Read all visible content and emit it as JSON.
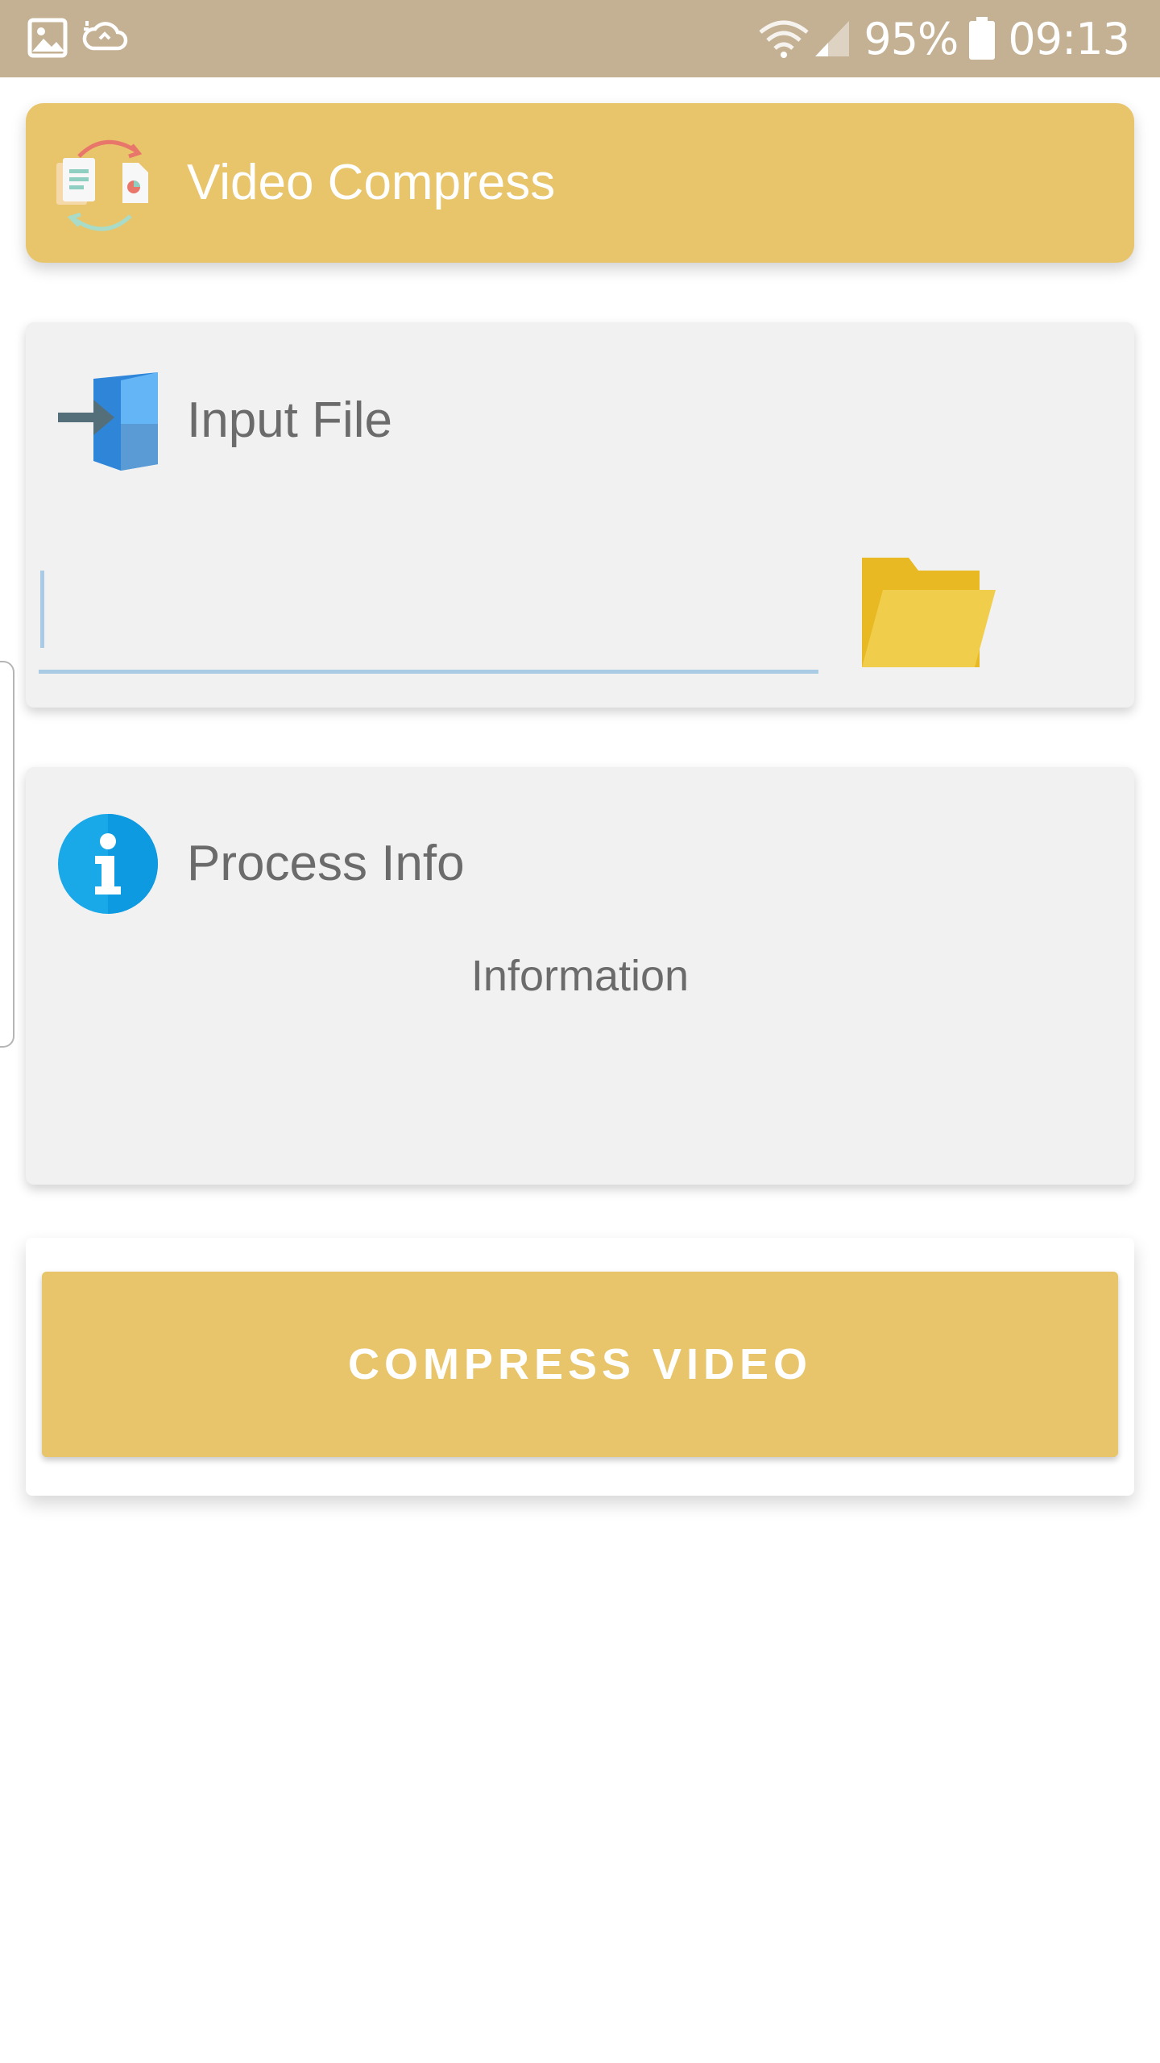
{
  "status_bar": {
    "battery": "95%",
    "time": "09:13",
    "left_icons": [
      "image-icon",
      "sync-cloud-icon"
    ],
    "right_icons": [
      "wifi-icon",
      "signal-icon",
      "battery-icon"
    ]
  },
  "app_bar": {
    "title": "Video Compress",
    "logo_icon": "file-convert-logo-icon",
    "color": "#e8c46a"
  },
  "input_card": {
    "title": "Input File",
    "icon": "file-import-icon",
    "input_value": "",
    "browse_icon": "folder-icon"
  },
  "info_card": {
    "title": "Process Info",
    "icon": "info-icon",
    "info_text": "Information"
  },
  "compress_button": {
    "label": "COMPRESS VIDEO",
    "color": "#e8c46a"
  },
  "colors": {
    "status_bar": "#c4b092",
    "card_background": "#f1f1f1",
    "text": "#6b6b6b",
    "input_underline": "#a9cbe3"
  }
}
